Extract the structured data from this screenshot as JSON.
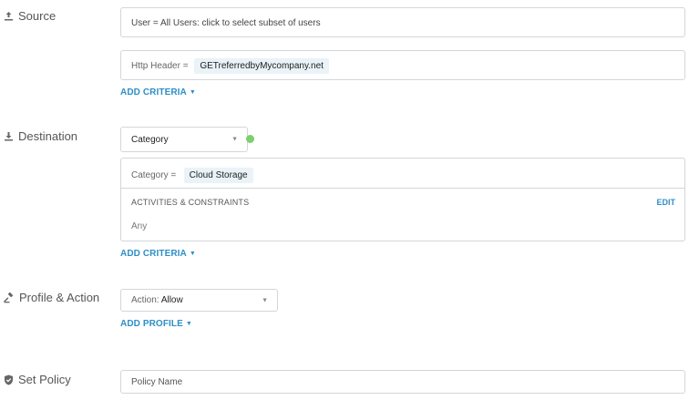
{
  "source": {
    "label": "Source",
    "users_text": "User = All Users: click to select subset of users",
    "header_label": "Http Header =",
    "header_value": "GETreferredbyMycompany.net",
    "add_criteria": "ADD CRITERIA"
  },
  "destination": {
    "label": "Destination",
    "select_value": "Category",
    "category_label": "Category =",
    "category_value": "Cloud Storage",
    "activities_title": "ACTIVITIES & CONSTRAINTS",
    "edit_label": "EDIT",
    "activities_value": "Any",
    "add_criteria": "ADD CRITERIA",
    "status_color": "#7dcf6e"
  },
  "profile": {
    "label": "Profile & Action",
    "action_prefix": "Action:",
    "action_value": "Allow",
    "add_profile": "ADD PROFILE"
  },
  "policy": {
    "label": "Set Policy",
    "name_placeholder": "Policy Name"
  },
  "icons": {
    "source": "upload-icon",
    "destination": "download-icon",
    "profile": "gavel-icon",
    "policy": "shield-check-icon"
  },
  "colors": {
    "link": "#2d8fc7",
    "chip_bg": "#e9f3f8",
    "border": "#d3d6da"
  }
}
